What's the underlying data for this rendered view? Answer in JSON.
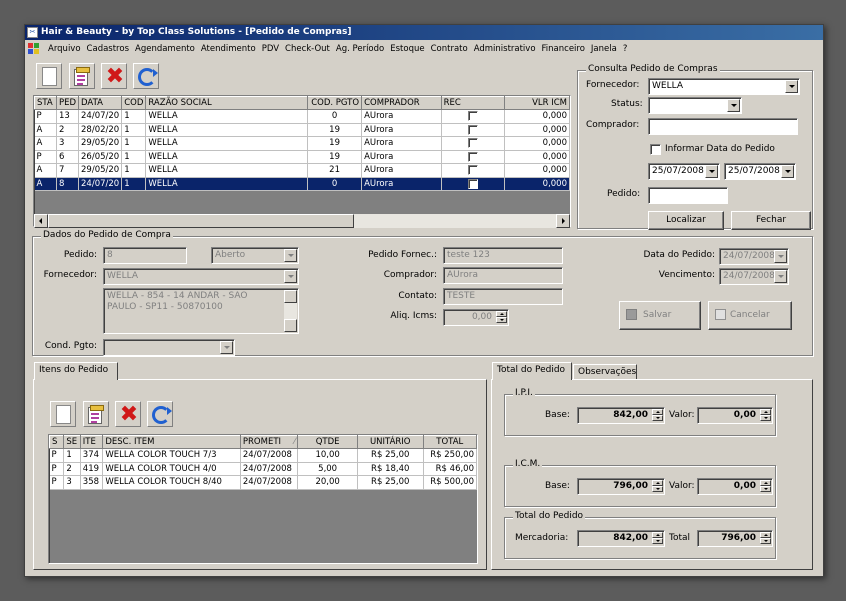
{
  "window": {
    "title": "Hair & Beauty - by Top Class Solutions - [Pedido de Compras]"
  },
  "menu": [
    "Arquivo",
    "Cadastros",
    "Agendamento",
    "Atendimento",
    "PDV",
    "Check-Out",
    "Ag. Período",
    "Estoque",
    "Contrato",
    "Administrativo",
    "Financeiro",
    "Janela",
    "?"
  ],
  "orders": {
    "columns": [
      "STA",
      "PED",
      "DATA",
      "COD",
      "RAZÃO SOCIAL",
      "COD. PGTO",
      "COMPRADOR",
      "REC",
      "VLR ICM"
    ],
    "rows": [
      {
        "sta": "P",
        "ped": "13",
        "data": "24/07/20",
        "cod": "1",
        "razao": "WELLA",
        "pgto": "0",
        "comprador": "AUrora",
        "vlr": "0,000",
        "selected": false
      },
      {
        "sta": "A",
        "ped": "2",
        "data": "28/02/20",
        "cod": "1",
        "razao": "WELLA",
        "pgto": "19",
        "comprador": "AUrora",
        "vlr": "0,000",
        "selected": false
      },
      {
        "sta": "A",
        "ped": "3",
        "data": "29/05/20",
        "cod": "1",
        "razao": "WELLA",
        "pgto": "19",
        "comprador": "AUrora",
        "vlr": "0,000",
        "selected": false
      },
      {
        "sta": "P",
        "ped": "6",
        "data": "26/05/20",
        "cod": "1",
        "razao": "WELLA",
        "pgto": "19",
        "comprador": "AUrora",
        "vlr": "0,000",
        "selected": false
      },
      {
        "sta": "A",
        "ped": "7",
        "data": "29/05/20",
        "cod": "1",
        "razao": "WELLA",
        "pgto": "21",
        "comprador": "AUrora",
        "vlr": "0,000",
        "selected": false
      },
      {
        "sta": "A",
        "ped": "8",
        "data": "24/07/20",
        "cod": "1",
        "razao": "WELLA",
        "pgto": "0",
        "comprador": "AUrora",
        "vlr": "0,000",
        "selected": true
      }
    ]
  },
  "consulta": {
    "title": "Consulta Pedido de Compras",
    "fornecedor_label": "Fornecedor:",
    "fornecedor_value": "WELLA",
    "status_label": "Status:",
    "status_value": "",
    "comprador_label": "Comprador:",
    "comprador_value": "",
    "informar_label": "Informar Data do Pedido",
    "date_from": "25/07/2008",
    "date_to": "25/07/2008",
    "pedido_label": "Pedido:",
    "pedido_value": "",
    "localizar": "Localizar",
    "fechar": "Fechar"
  },
  "dados": {
    "title": "Dados do Pedido de Compra",
    "pedido_label": "Pedido:",
    "pedido_value": "8",
    "status_value": "Aberto",
    "fornecedor_label": "Fornecedor:",
    "fornecedor_value": "WELLA",
    "address": "WELLA - 854 - 14 ANDAR - SAO PAULO - SP11 - 50870100",
    "cond_label": "Cond. Pgto:",
    "cond_value": "",
    "pedido_fornec_label": "Pedido Fornec.:",
    "pedido_fornec_value": "teste 123",
    "comprador_label": "Comprador:",
    "comprador_value": "AUrora",
    "contato_label": "Contato:",
    "contato_value": "TESTE",
    "aliq_label": "Aliq. Icms:",
    "aliq_value": "0,00",
    "data_pedido_label": "Data do Pedido:",
    "data_pedido_value": "24/07/2008",
    "vencimento_label": "Vencimento:",
    "vencimento_value": "24/07/2008",
    "salvar": "Salvar",
    "cancelar": "Cancelar"
  },
  "itens": {
    "tab": "Itens do Pedido",
    "columns": [
      "S",
      "SE",
      "ITE",
      "DESC. ITEM",
      "PROMETI",
      "QTDE",
      "UNITÁRIO",
      "TOTAL"
    ],
    "rows": [
      {
        "s": "P",
        "se": "1",
        "ite": "374",
        "desc": "WELLA COLOR TOUCH 7/3",
        "prometi": "24/07/2008",
        "qtde": "10,00",
        "unit": "R$ 25,00",
        "total": "R$ 250,00"
      },
      {
        "s": "P",
        "se": "2",
        "ite": "419",
        "desc": "WELLA COLOR TOUCH 4/0",
        "prometi": "24/07/2008",
        "qtde": "5,00",
        "unit": "R$ 18,40",
        "total": "R$ 46,00"
      },
      {
        "s": "P",
        "se": "3",
        "ite": "358",
        "desc": "WELLA COLOR TOUCH 8/40",
        "prometi": "24/07/2008",
        "qtde": "20,00",
        "unit": "R$ 25,00",
        "total": "R$ 500,00"
      }
    ]
  },
  "totais": {
    "tab_total": "Total do Pedido",
    "tab_obs": "Observações",
    "ipi_title": "I.P.I.",
    "ipi_base_label": "Base:",
    "ipi_base": "842,00",
    "ipi_valor_label": "Valor:",
    "ipi_valor": "0,00",
    "icm_title": "I.C.M.",
    "icm_base_label": "Base:",
    "icm_base": "796,00",
    "icm_valor_label": "Valor:",
    "icm_valor": "0,00",
    "total_title": "Total do Pedido",
    "merc_label": "Mercadoria:",
    "merc_value": "842,00",
    "total_label": "Total",
    "total_value": "796,00"
  }
}
